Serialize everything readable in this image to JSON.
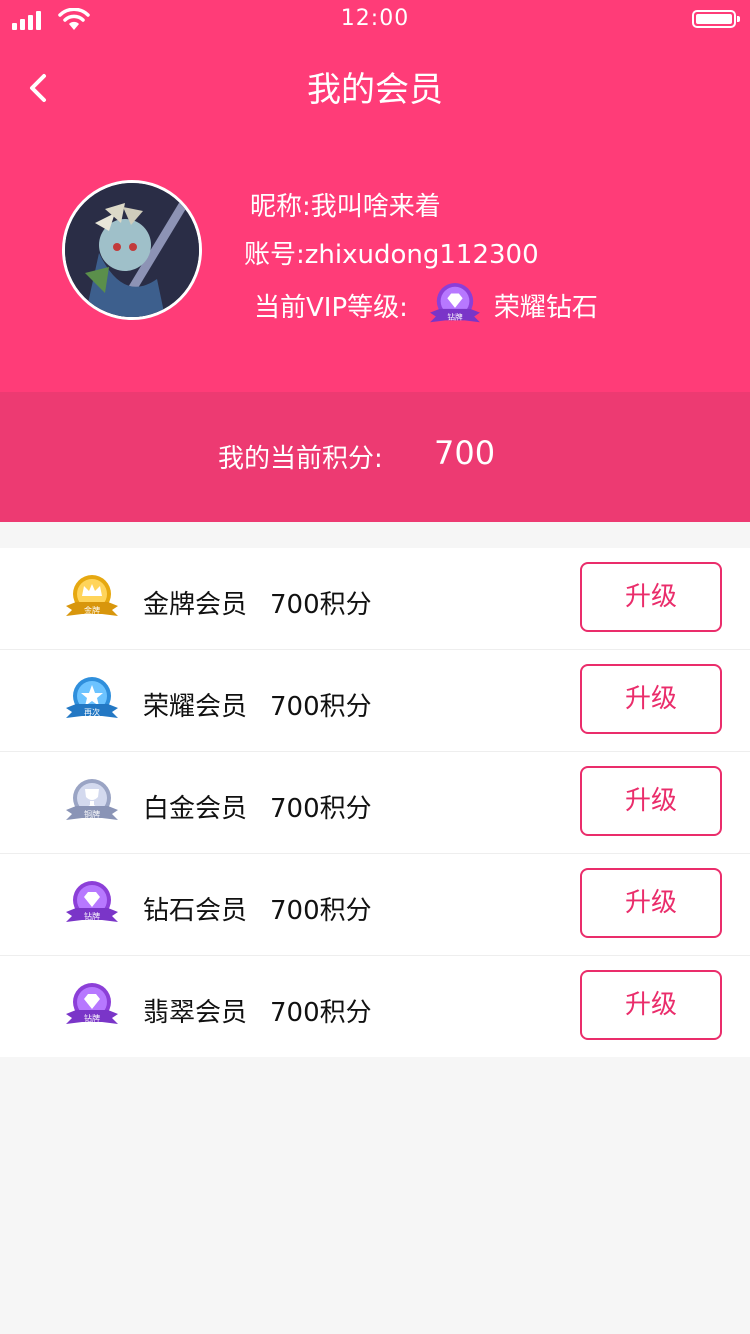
{
  "status_bar": {
    "time": "12:00"
  },
  "nav": {
    "title": "我的会员"
  },
  "profile": {
    "nickname_label": "昵称:",
    "nickname": "我叫啥来着",
    "account_label": "账号:",
    "account": "zhixudong112300",
    "vip_label": "当前VIP等级:",
    "vip_level": "荣耀钻石",
    "vip_badge_text": "钻牌"
  },
  "points": {
    "label": "我的当前积分:",
    "value": "700"
  },
  "tiers": [
    {
      "name": "金牌会员",
      "points": "700积分",
      "button": "升级",
      "badge_text": "金牌",
      "badge_color": "#f0b51f"
    },
    {
      "name": "荣耀会员",
      "points": "700积分",
      "button": "升级",
      "badge_text": "再次",
      "badge_color": "#3fa3e8"
    },
    {
      "name": "白金会员",
      "points": "700积分",
      "button": "升级",
      "badge_text": "铜牌",
      "badge_color": "#aab4d0"
    },
    {
      "name": "钻石会员",
      "points": "700积分",
      "button": "升级",
      "badge_text": "钻牌",
      "badge_color": "#9a4fe0"
    },
    {
      "name": "翡翠会员",
      "points": "700积分",
      "button": "升级",
      "badge_text": "钻牌",
      "badge_color": "#9a4fe0"
    }
  ],
  "colors": {
    "header": "#ff3c78",
    "points_bar": "#ed3a72",
    "accent": "#ea2d6b"
  }
}
